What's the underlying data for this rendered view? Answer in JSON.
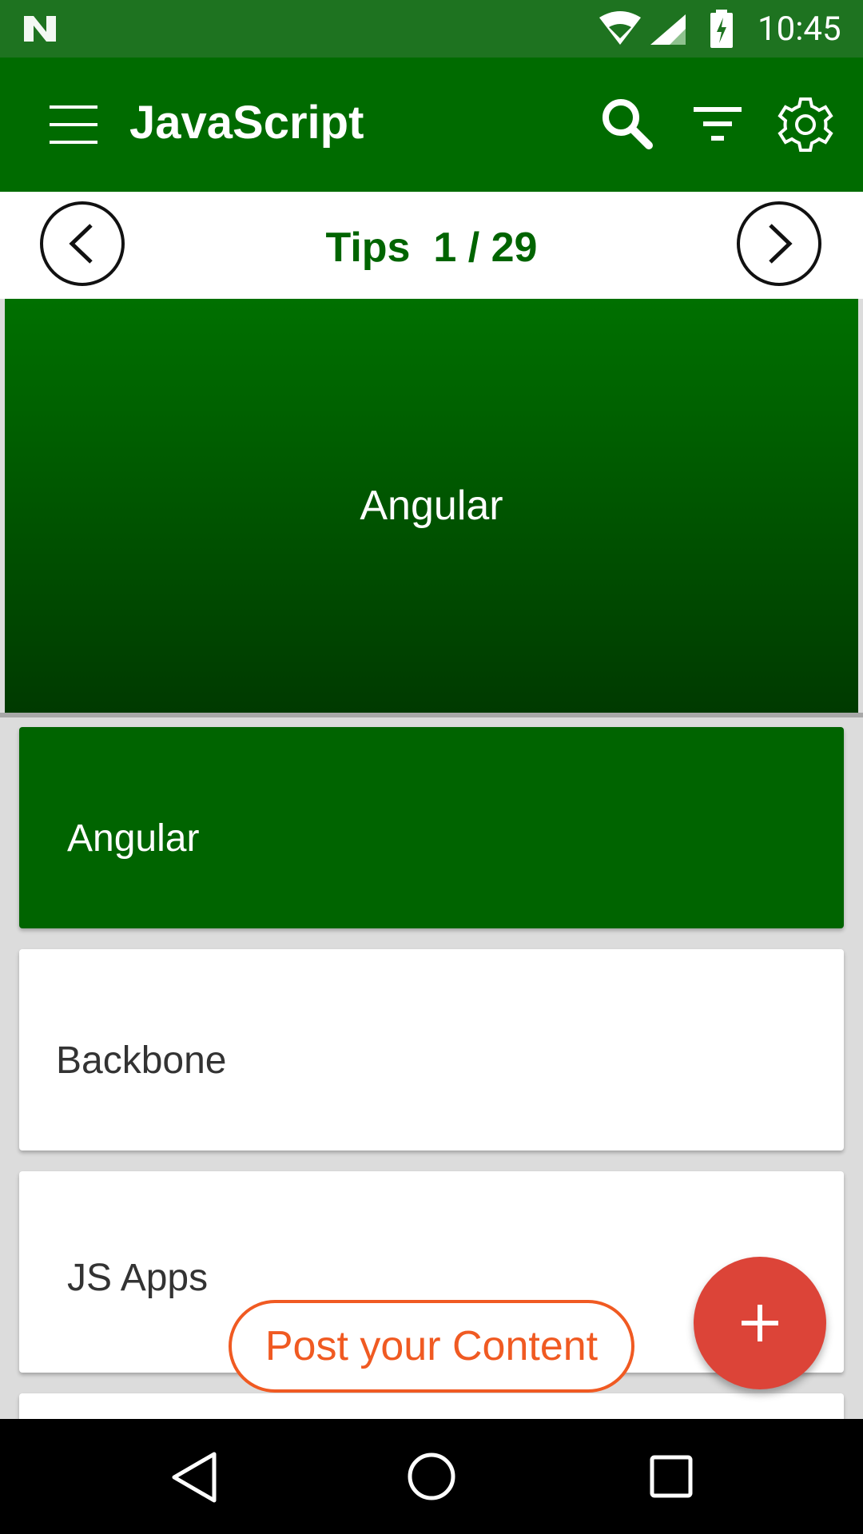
{
  "status_bar": {
    "time": "10:45"
  },
  "app_bar": {
    "title": "JavaScript",
    "icons": [
      "menu-icon",
      "search-icon",
      "filter-icon",
      "settings-gear-icon"
    ]
  },
  "pager": {
    "label": "Tips  1 / 29"
  },
  "hero": {
    "text": "Angular"
  },
  "list": {
    "items": [
      {
        "label": "Angular",
        "selected": true
      },
      {
        "label": "Backbone",
        "selected": false
      },
      {
        "label": "JS Apps",
        "selected": false
      }
    ]
  },
  "post_button": {
    "label": "Post your Content"
  },
  "fab": {
    "label": "+"
  },
  "colors": {
    "primary": "#006b00",
    "status_bar": "#1e7320",
    "accent_fab": "#dc4438",
    "post_outline": "#f05a22"
  }
}
